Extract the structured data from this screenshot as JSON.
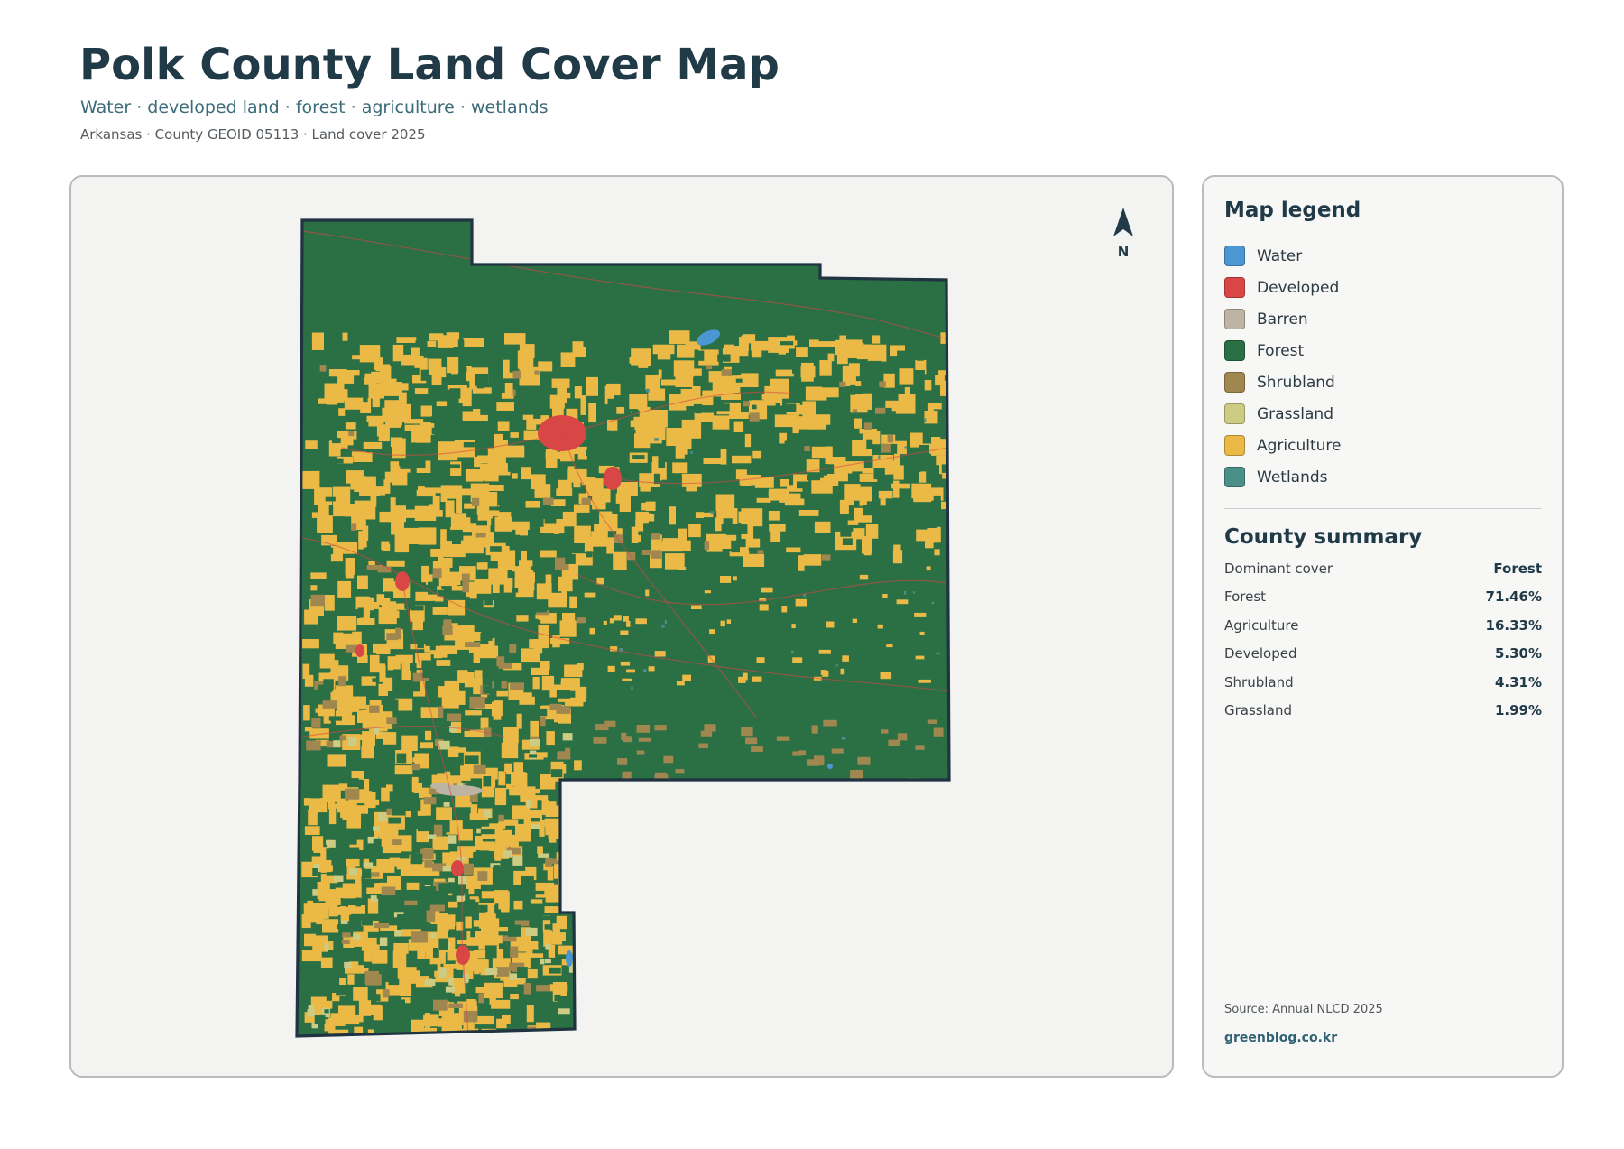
{
  "header": {
    "title": "Polk County Land Cover Map",
    "subtitle": "Water · developed land · forest · agriculture · wetlands",
    "meta": "Arkansas · County GEOID 05113 · Land cover 2025"
  },
  "map": {
    "north_label": "N",
    "north_arrow_icon": "north-arrow-icon",
    "background_color": "#f3f3f2",
    "border_color": "#1f3340"
  },
  "legend": {
    "title": "Map legend",
    "items": [
      {
        "label": "Water",
        "color": "#4a97d4"
      },
      {
        "label": "Developed",
        "color": "#d94646"
      },
      {
        "label": "Barren",
        "color": "#bdb4a4"
      },
      {
        "label": "Forest",
        "color": "#2b6f45"
      },
      {
        "label": "Shrubland",
        "color": "#a0874f"
      },
      {
        "label": "Grassland",
        "color": "#cdcc84"
      },
      {
        "label": "Agriculture",
        "color": "#eab946"
      },
      {
        "label": "Wetlands",
        "color": "#4b8f89"
      }
    ]
  },
  "summary": {
    "title": "County summary",
    "rows": [
      {
        "label": "Dominant cover",
        "value": "Forest"
      },
      {
        "label": "Forest",
        "value": "71.46%"
      },
      {
        "label": "Agriculture",
        "value": "16.33%"
      },
      {
        "label": "Developed",
        "value": "5.30%"
      },
      {
        "label": "Shrubland",
        "value": "4.31%"
      },
      {
        "label": "Grassland",
        "value": "1.99%"
      }
    ]
  },
  "footer": {
    "source": "Source: Annual NLCD 2025",
    "credit": "greenblog.co.kr"
  }
}
